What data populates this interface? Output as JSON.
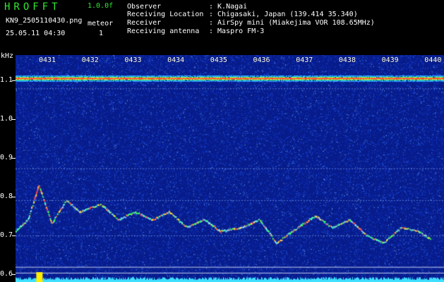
{
  "header": {
    "brand": "HROFFT",
    "version": "1.0.0f",
    "filename": "KN9_2505110430.png",
    "datetime": "25.05.11 04:30",
    "meteor_label": "meteor",
    "meteor_count": "1",
    "fields": [
      {
        "label": "Observer",
        "value": ": K.Nagai"
      },
      {
        "label": "Receiving Location",
        "value": ": Chigasaki, Japan (139.414 35.340)"
      },
      {
        "label": "Receiver",
        "value": ": AirSpy mini (Miakejima VOR 108.65MHz)"
      },
      {
        "label": "Receiving antenna",
        "value": ": Maspro FM-3"
      }
    ]
  },
  "chart_data": {
    "type": "heatmap",
    "ylabel": "kHz",
    "y_ticks": [
      "1.1",
      "1.0",
      "0.9",
      "0.8",
      "0.7",
      "0.6"
    ],
    "ylim": [
      0.58,
      1.165
    ],
    "time_ticks": [
      "0431",
      "0432",
      "0433",
      "0434",
      "0435",
      "0436",
      "0437",
      "0438",
      "0439",
      "0440"
    ],
    "carrier_khz": 1.105,
    "meteor_echoes": 1,
    "trace_khz": [
      {
        "t": 0.0,
        "f": 0.71
      },
      {
        "t": 0.3,
        "f": 0.74
      },
      {
        "t": 0.55,
        "f": 0.83
      },
      {
        "t": 0.85,
        "f": 0.73
      },
      {
        "t": 1.2,
        "f": 0.79
      },
      {
        "t": 1.5,
        "f": 0.76
      },
      {
        "t": 2.0,
        "f": 0.78
      },
      {
        "t": 2.4,
        "f": 0.74
      },
      {
        "t": 2.8,
        "f": 0.76
      },
      {
        "t": 3.2,
        "f": 0.74
      },
      {
        "t": 3.6,
        "f": 0.76
      },
      {
        "t": 4.0,
        "f": 0.72
      },
      {
        "t": 4.4,
        "f": 0.74
      },
      {
        "t": 4.8,
        "f": 0.71
      },
      {
        "t": 5.3,
        "f": 0.72
      },
      {
        "t": 5.7,
        "f": 0.74
      },
      {
        "t": 6.1,
        "f": 0.68
      },
      {
        "t": 6.6,
        "f": 0.72
      },
      {
        "t": 7.0,
        "f": 0.75
      },
      {
        "t": 7.4,
        "f": 0.72
      },
      {
        "t": 7.8,
        "f": 0.74
      },
      {
        "t": 8.2,
        "f": 0.7
      },
      {
        "t": 8.6,
        "f": 0.68
      },
      {
        "t": 9.0,
        "f": 0.72
      },
      {
        "t": 9.4,
        "f": 0.71
      },
      {
        "t": 9.7,
        "f": 0.69
      }
    ]
  }
}
